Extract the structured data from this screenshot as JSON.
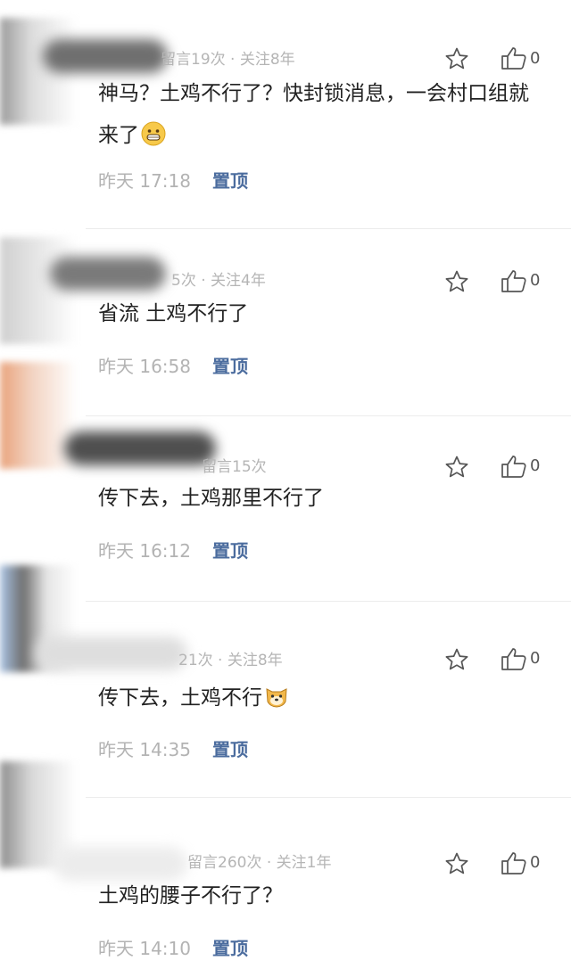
{
  "comments": [
    {
      "meta": "留言19次 · 关注8年",
      "text": "神马？土鸡不行了？快封锁消息，一会村口组就来了",
      "time": "昨天 17:18",
      "pin": "置顶",
      "likes": "0",
      "emoji": "grinning-emoji"
    },
    {
      "meta": "5次 · 关注4年",
      "text": "省流 土鸡不行了",
      "time": "昨天 16:58",
      "pin": "置顶",
      "likes": "0"
    },
    {
      "meta": "留言15次",
      "text": "传下去，土鸡那里不行了",
      "time": "昨天 16:12",
      "pin": "置顶",
      "likes": "0"
    },
    {
      "meta": "21次 · 关注8年",
      "text": "传下去，土鸡不行",
      "time": "昨天 14:35",
      "pin": "置顶",
      "likes": "0",
      "emoji": "dog-face-emoji"
    },
    {
      "meta": "留言260次 · 关注1年",
      "text": "土鸡的腰子不行了？",
      "time": "昨天 14:10",
      "pin": "置顶",
      "likes": "0"
    }
  ],
  "icons": {
    "star": "star-outline-icon",
    "like": "thumbs-up-outline-icon"
  },
  "colors": {
    "pin": "#4b6c9e",
    "meta": "#b5b5b5",
    "text": "#222222"
  }
}
